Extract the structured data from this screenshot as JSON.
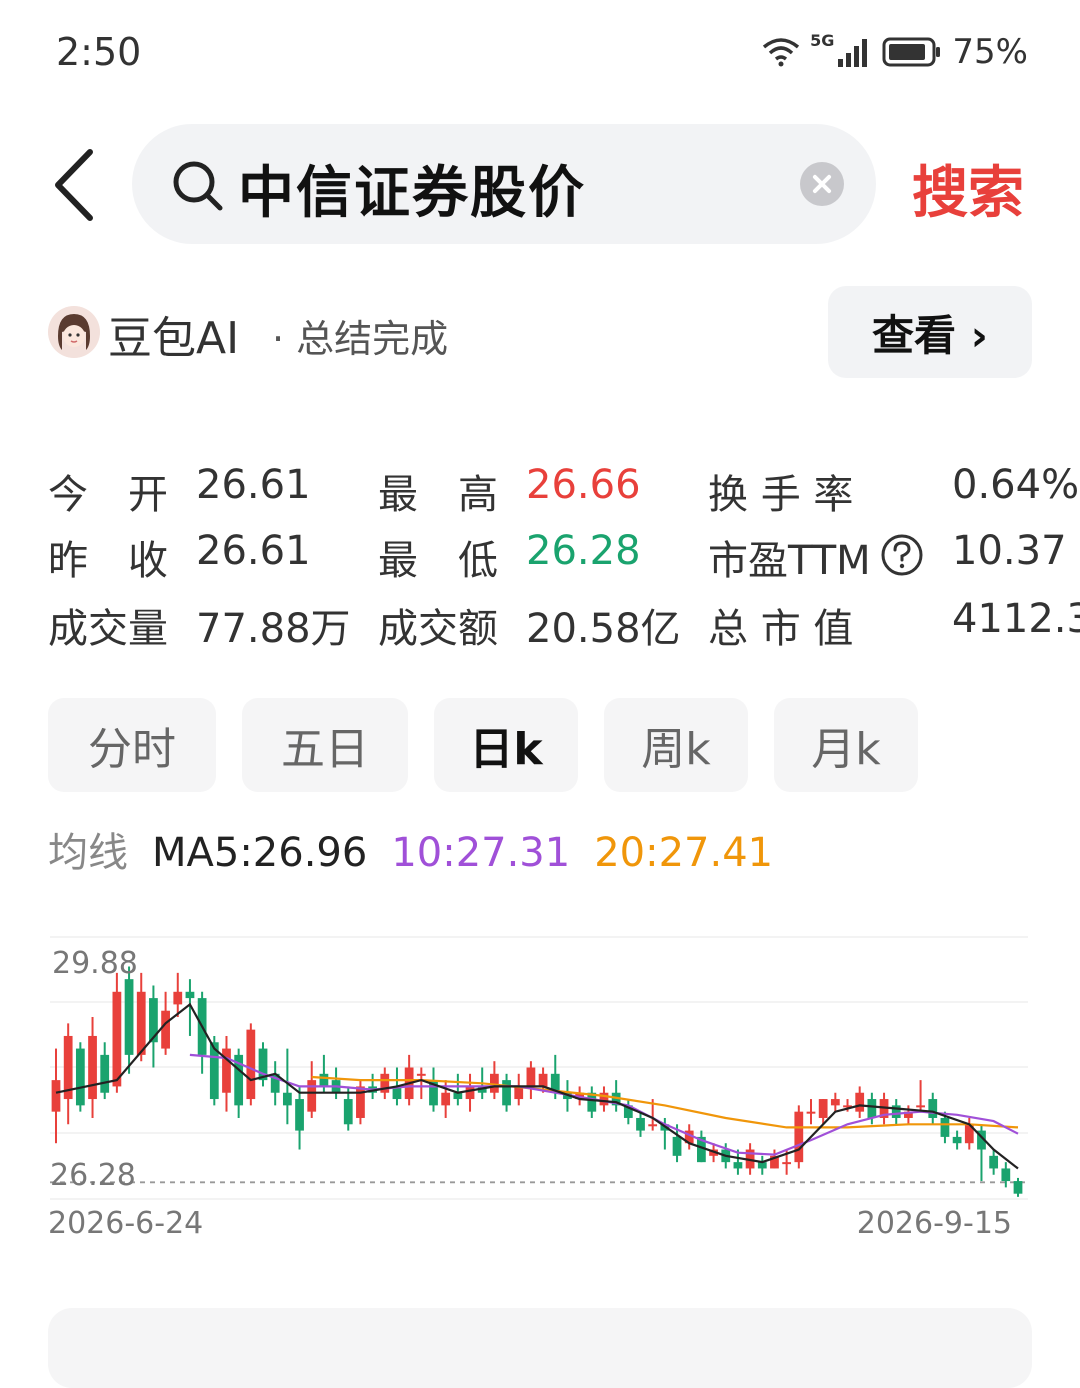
{
  "status_bar": {
    "time": "2:50",
    "network": "5G",
    "battery": "75%"
  },
  "search": {
    "query": "中信证券股价",
    "button_label": "搜索"
  },
  "ai_summary": {
    "name": "豆包AI",
    "status": "· 总结完成",
    "view_label": "查看 ›"
  },
  "quote": {
    "rows": [
      [
        {
          "label": "今　开",
          "value": "26.61",
          "color": "normal"
        },
        {
          "label": "最　高",
          "value": "26.66",
          "color": "red"
        },
        {
          "label": "换 手 率",
          "value": "0.64%",
          "color": "normal"
        }
      ],
      [
        {
          "label": "昨　收",
          "value": "26.61",
          "color": "normal"
        },
        {
          "label": "最　低",
          "value": "26.28",
          "color": "green"
        },
        {
          "label": "市盈TTM",
          "value": "10.37",
          "color": "normal"
        }
      ],
      [
        {
          "label": "成交量",
          "value": "77.88万",
          "color": "normal"
        },
        {
          "label": "成交额",
          "value": "20.58亿",
          "color": "normal"
        },
        {
          "label": "总 市 值",
          "value": "4112.3",
          "color": "normal"
        }
      ]
    ]
  },
  "tabs": [
    "分时",
    "五日",
    "日k",
    "周k",
    "月k"
  ],
  "active_tab": 2,
  "ma": {
    "label": "均线",
    "ma5": "MA5:26.96",
    "ma10": "10:27.31",
    "ma20": "20:27.41"
  },
  "colors": {
    "up": "#e8403b",
    "down": "#1aa36e",
    "ma5": "#222222",
    "ma10": "#a050d8",
    "ma20": "#f0960a"
  },
  "chart_data": {
    "type": "candlestick",
    "y_labels": [
      "29.88",
      "26.28"
    ],
    "x_labels": [
      "2026-6-24",
      "2026-9-15"
    ],
    "ylim": [
      26.0,
      30.2
    ],
    "candles": [
      [
        27.4,
        27.9,
        28.4,
        26.9
      ],
      [
        27.6,
        28.6,
        28.8,
        27.2
      ],
      [
        28.4,
        27.5,
        28.5,
        27.4
      ],
      [
        27.6,
        28.6,
        28.9,
        27.3
      ],
      [
        28.3,
        27.7,
        28.5,
        27.6
      ],
      [
        27.8,
        29.3,
        29.6,
        27.7
      ],
      [
        29.5,
        28.3,
        29.7,
        28.0
      ],
      [
        28.3,
        29.3,
        29.6,
        28.2
      ],
      [
        29.2,
        28.5,
        29.4,
        28.1
      ],
      [
        28.4,
        29.0,
        29.3,
        28.3
      ],
      [
        29.1,
        29.3,
        29.6,
        28.9
      ],
      [
        29.3,
        29.2,
        29.5,
        28.6
      ],
      [
        29.2,
        28.3,
        29.3,
        28.0
      ],
      [
        28.5,
        27.6,
        28.6,
        27.5
      ],
      [
        27.7,
        28.4,
        28.6,
        27.4
      ],
      [
        28.3,
        27.5,
        28.4,
        27.3
      ],
      [
        27.6,
        28.7,
        28.8,
        27.5
      ],
      [
        28.4,
        27.9,
        28.5,
        27.8
      ],
      [
        28.0,
        27.7,
        28.2,
        27.5
      ],
      [
        27.7,
        27.5,
        28.4,
        27.2
      ],
      [
        27.6,
        27.1,
        27.8,
        26.8
      ],
      [
        27.4,
        27.9,
        28.2,
        27.3
      ],
      [
        28.0,
        27.8,
        28.3,
        27.7
      ],
      [
        27.9,
        27.7,
        28.1,
        27.6
      ],
      [
        27.6,
        27.2,
        27.8,
        27.1
      ],
      [
        27.3,
        27.8,
        27.9,
        27.2
      ],
      [
        27.8,
        27.7,
        28.0,
        27.6
      ],
      [
        27.7,
        28.0,
        28.1,
        27.6
      ],
      [
        27.8,
        27.6,
        28.1,
        27.5
      ],
      [
        27.6,
        28.1,
        28.3,
        27.5
      ],
      [
        28.0,
        28.0,
        28.1,
        27.6
      ],
      [
        27.9,
        27.5,
        28.1,
        27.4
      ],
      [
        27.5,
        27.7,
        27.9,
        27.3
      ],
      [
        27.7,
        27.6,
        28.0,
        27.5
      ],
      [
        27.6,
        27.8,
        28.0,
        27.4
      ],
      [
        27.8,
        27.7,
        28.1,
        27.6
      ],
      [
        27.7,
        28.0,
        28.2,
        27.6
      ],
      [
        27.9,
        27.5,
        28.0,
        27.4
      ],
      [
        27.6,
        27.8,
        28.0,
        27.5
      ],
      [
        27.8,
        28.1,
        28.2,
        27.6
      ],
      [
        27.8,
        28.0,
        28.1,
        27.7
      ],
      [
        28.0,
        27.7,
        28.3,
        27.6
      ],
      [
        27.7,
        27.6,
        27.9,
        27.4
      ],
      [
        27.6,
        27.7,
        27.8,
        27.5
      ],
      [
        27.7,
        27.4,
        27.8,
        27.3
      ],
      [
        27.5,
        27.7,
        27.8,
        27.4
      ],
      [
        27.7,
        27.5,
        27.9,
        27.4
      ],
      [
        27.5,
        27.3,
        27.6,
        27.2
      ],
      [
        27.3,
        27.1,
        27.4,
        27.0
      ],
      [
        27.2,
        27.2,
        27.6,
        27.1
      ],
      [
        27.2,
        27.1,
        27.3,
        26.8
      ],
      [
        27.0,
        26.7,
        27.2,
        26.6
      ],
      [
        26.9,
        27.1,
        27.2,
        26.8
      ],
      [
        27.0,
        26.6,
        27.1,
        26.6
      ],
      [
        26.7,
        26.8,
        26.9,
        26.6
      ],
      [
        26.8,
        26.6,
        26.9,
        26.5
      ],
      [
        26.6,
        26.5,
        26.8,
        26.4
      ],
      [
        26.5,
        26.8,
        26.9,
        26.4
      ],
      [
        26.6,
        26.5,
        26.7,
        26.4
      ],
      [
        26.5,
        26.7,
        26.8,
        26.5
      ],
      [
        26.6,
        26.6,
        26.8,
        26.4
      ],
      [
        26.6,
        27.4,
        27.5,
        26.5
      ],
      [
        27.4,
        27.4,
        27.6,
        27.2
      ],
      [
        27.3,
        27.6,
        27.6,
        27.2
      ],
      [
        27.5,
        27.6,
        27.7,
        27.4
      ],
      [
        27.5,
        27.5,
        27.6,
        27.4
      ],
      [
        27.4,
        27.7,
        27.8,
        27.3
      ],
      [
        27.6,
        27.3,
        27.7,
        27.2
      ],
      [
        27.3,
        27.6,
        27.7,
        27.2
      ],
      [
        27.5,
        27.3,
        27.6,
        27.2
      ],
      [
        27.3,
        27.4,
        27.5,
        27.2
      ],
      [
        27.5,
        27.5,
        27.9,
        27.4
      ],
      [
        27.6,
        27.3,
        27.7,
        27.2
      ],
      [
        27.3,
        27.0,
        27.4,
        26.9
      ],
      [
        27.0,
        26.9,
        27.1,
        26.8
      ],
      [
        26.9,
        27.2,
        27.3,
        26.8
      ],
      [
        27.1,
        26.8,
        27.2,
        26.3
      ],
      [
        26.7,
        26.5,
        26.8,
        26.4
      ],
      [
        26.5,
        26.3,
        26.6,
        26.2
      ],
      [
        26.3,
        26.1,
        26.35,
        26.05
      ]
    ],
    "ma5": [
      [
        0,
        27.7
      ],
      [
        5,
        27.9
      ],
      [
        9,
        28.8
      ],
      [
        11,
        29.1
      ],
      [
        13,
        28.4
      ],
      [
        16,
        27.9
      ],
      [
        18,
        28.0
      ],
      [
        20,
        27.7
      ],
      [
        23,
        27.7
      ],
      [
        25,
        27.7
      ],
      [
        28,
        27.8
      ],
      [
        30,
        27.9
      ],
      [
        33,
        27.7
      ],
      [
        36,
        27.8
      ],
      [
        40,
        27.8
      ],
      [
        43,
        27.6
      ],
      [
        46,
        27.55
      ],
      [
        49,
        27.3
      ],
      [
        52,
        26.9
      ],
      [
        55,
        26.7
      ],
      [
        58,
        26.6
      ],
      [
        61,
        26.8
      ],
      [
        64,
        27.4
      ],
      [
        66,
        27.5
      ],
      [
        69,
        27.45
      ],
      [
        72,
        27.4
      ],
      [
        75,
        27.2
      ],
      [
        77,
        26.8
      ],
      [
        79,
        26.5
      ]
    ],
    "ma10": [
      [
        11,
        28.3
      ],
      [
        14,
        28.25
      ],
      [
        17,
        28.0
      ],
      [
        20,
        27.8
      ],
      [
        23,
        27.8
      ],
      [
        26,
        27.75
      ],
      [
        29,
        27.8
      ],
      [
        32,
        27.8
      ],
      [
        35,
        27.8
      ],
      [
        38,
        27.8
      ],
      [
        41,
        27.7
      ],
      [
        44,
        27.6
      ],
      [
        47,
        27.5
      ],
      [
        50,
        27.2
      ],
      [
        53,
        26.95
      ],
      [
        56,
        26.75
      ],
      [
        59,
        26.72
      ],
      [
        62,
        26.95
      ],
      [
        65,
        27.2
      ],
      [
        68,
        27.35
      ],
      [
        71,
        27.4
      ],
      [
        74,
        27.35
      ],
      [
        77,
        27.25
      ],
      [
        79,
        27.05
      ]
    ],
    "ma20": [
      [
        21,
        27.95
      ],
      [
        25,
        27.9
      ],
      [
        30,
        27.9
      ],
      [
        35,
        27.85
      ],
      [
        40,
        27.75
      ],
      [
        45,
        27.65
      ],
      [
        50,
        27.5
      ],
      [
        55,
        27.3
      ],
      [
        60,
        27.15
      ],
      [
        65,
        27.15
      ],
      [
        70,
        27.2
      ],
      [
        75,
        27.2
      ],
      [
        79,
        27.15
      ]
    ]
  }
}
